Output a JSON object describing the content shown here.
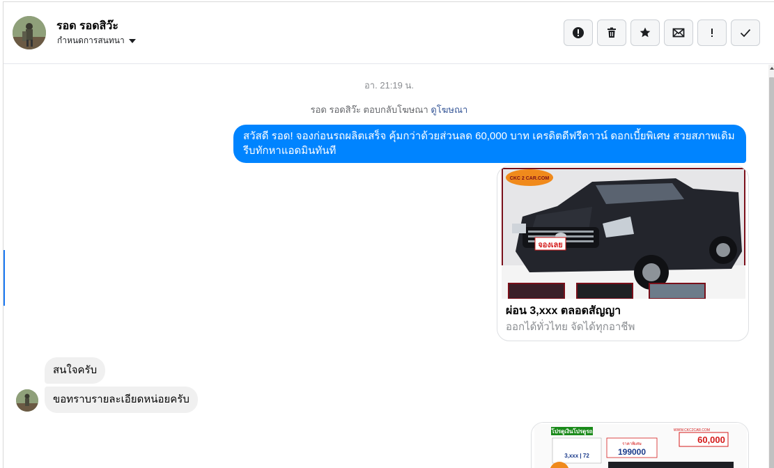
{
  "header": {
    "contact_name": "รอด รอดสิว๊ะ",
    "settings_label": "กำหนดการสนทนา",
    "actions": [
      {
        "name": "report-button",
        "icon": "alert-circle-icon"
      },
      {
        "name": "delete-button",
        "icon": "trash-icon"
      },
      {
        "name": "star-button",
        "icon": "star-icon"
      },
      {
        "name": "mark-unread-button",
        "icon": "envelope-icon"
      },
      {
        "name": "spam-button",
        "icon": "exclamation-icon"
      },
      {
        "name": "mark-done-button",
        "icon": "checkmark-icon"
      }
    ]
  },
  "thread": {
    "timestamp": "อา. 21:19 น.",
    "ad_reply_text": "รอด รอดสิว๊ะ ตอบกลับโฆษณา",
    "ad_reply_link": "ดูโฆษณา",
    "outgoing_message": "สวัสดี รอด! จองก่อนรถผลิตเสร็จ คุ้มกว่าด้วยส่วนลด 60,000 บาท เครดิตดีฟรีดาวน์ ดอกเบี้ยพิเศษ สวยสภาพเดิม รีบทักหาแอดมินทันที",
    "ad_card": {
      "title": "ผ่อน 3,xxx ตลอดสัญญา",
      "subtitle": "ออกได้ทั่วไทย จัดได้ทุกอาชีพ",
      "image_logo": "CKC 2 CAR.COM",
      "image_badge": "จองเลย"
    },
    "incoming_messages": [
      "สนใจครับ",
      "ขอทราบรายละเอียดหน่อยครับ"
    ],
    "ad_card_2": {
      "headline": "โปรดูเงินโปรดูรถ",
      "price_label": "ราคาพิเศษ",
      "price": "199000",
      "discount": "60,000",
      "installment": "3,xxx | 72",
      "site": "WWW.CKC2CAR.COM"
    }
  },
  "colors": {
    "accent": "#0084ff",
    "incoming_bg": "#f0f0f0",
    "link": "#385898"
  }
}
